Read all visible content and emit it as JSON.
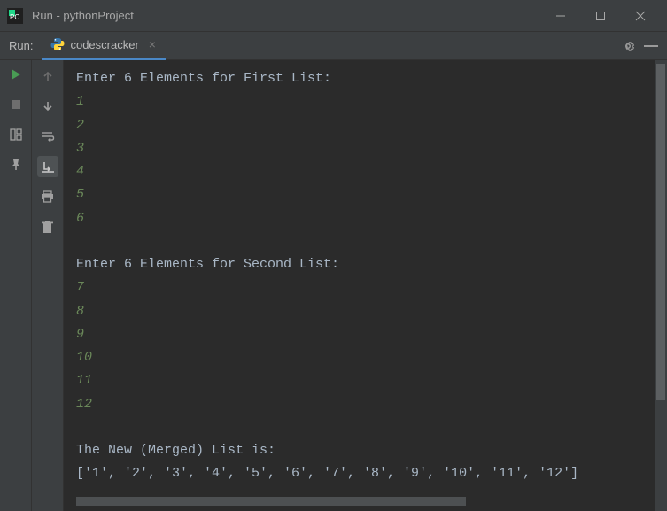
{
  "window": {
    "title": "Run - pythonProject"
  },
  "toolheader": {
    "run_label": "Run:",
    "tab_label": "codescracker"
  },
  "console": {
    "lines": [
      {
        "type": "prompt",
        "text": "Enter 6 Elements for First List:"
      },
      {
        "type": "input",
        "text": "1"
      },
      {
        "type": "input",
        "text": "2"
      },
      {
        "type": "input",
        "text": "3"
      },
      {
        "type": "input",
        "text": "4"
      },
      {
        "type": "input",
        "text": "5"
      },
      {
        "type": "input",
        "text": "6"
      },
      {
        "type": "blank",
        "text": ""
      },
      {
        "type": "prompt",
        "text": "Enter 6 Elements for Second List:"
      },
      {
        "type": "input",
        "text": "7"
      },
      {
        "type": "input",
        "text": "8"
      },
      {
        "type": "input",
        "text": "9"
      },
      {
        "type": "input",
        "text": "10"
      },
      {
        "type": "input",
        "text": "11"
      },
      {
        "type": "input",
        "text": "12"
      },
      {
        "type": "blank",
        "text": ""
      },
      {
        "type": "prompt",
        "text": "The New (Merged) List is:"
      },
      {
        "type": "output",
        "text": "['1', '2', '3', '4', '5', '6', '7', '8', '9', '10', '11', '12']"
      }
    ]
  },
  "icons": {
    "run": "run-icon",
    "stop": "stop-icon",
    "layout": "layout-icon",
    "pin": "pin-icon",
    "up": "up-arrow-icon",
    "down": "down-arrow-icon",
    "wrap": "soft-wrap-icon",
    "scroll_end": "scroll-to-end-icon",
    "print": "print-icon",
    "trash": "trash-icon",
    "gear": "gear-icon",
    "hide": "hide-icon"
  }
}
